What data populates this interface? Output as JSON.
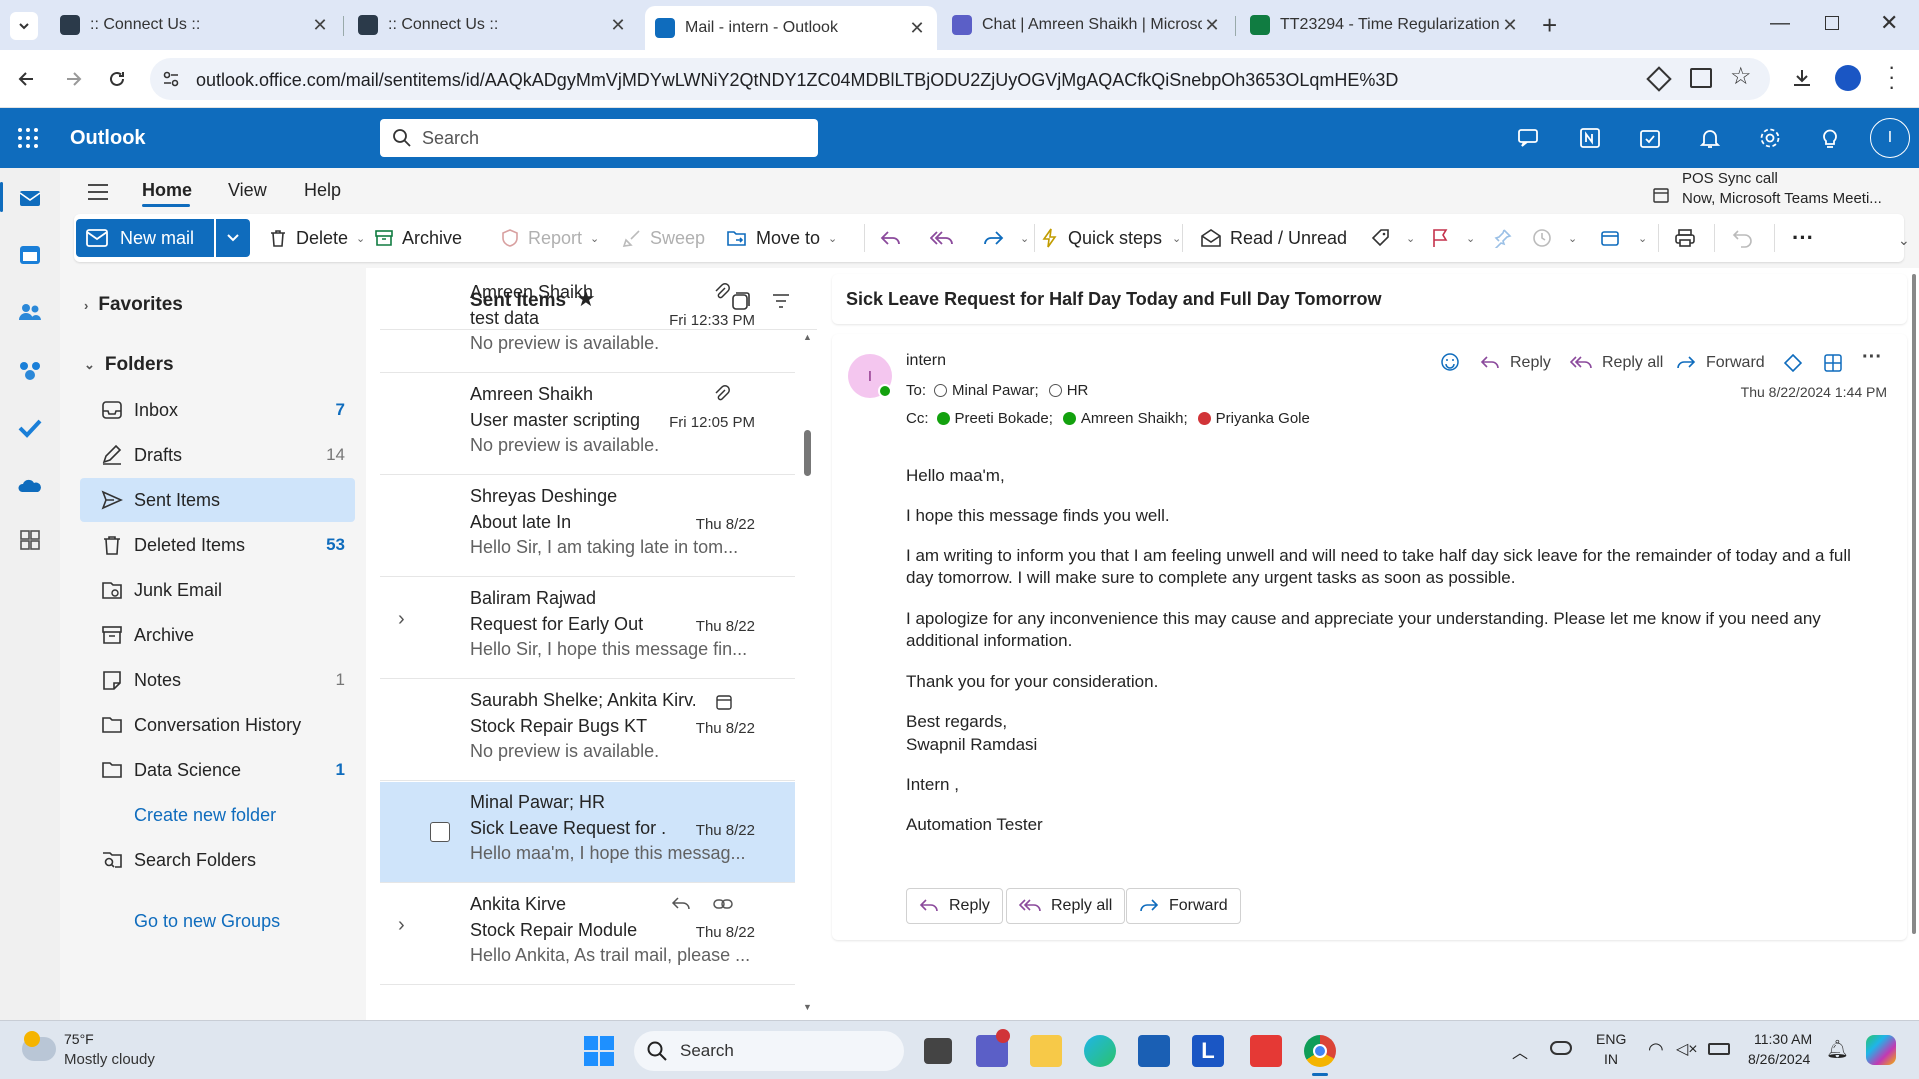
{
  "browser": {
    "tabs": [
      {
        "title": ":: Connect Us ::",
        "active": false
      },
      {
        "title": ":: Connect Us ::",
        "active": false
      },
      {
        "title": "Mail - intern - Outlook",
        "active": true
      },
      {
        "title": "Chat | Amreen Shaikh | Microso",
        "active": false
      },
      {
        "title": "TT23294 - Time Regularization",
        "active": false
      }
    ],
    "url": "outlook.office.com/mail/sentitems/id/AAQkADgyMmVjMDYwLWNiY2QtNDY1ZC04MDBlLTBjODU2ZjUyOGVjMgAQACfkQiSnebpOh3653OLqmHE%3D"
  },
  "header": {
    "app_name": "Outlook",
    "search_placeholder": "Search",
    "avatar_initial": "I"
  },
  "ribbon": {
    "tabs": [
      "Home",
      "View",
      "Help"
    ],
    "active_tab": "Home",
    "reminder_title": "POS Sync call",
    "reminder_sub": "Now, Microsoft Teams Meeti...",
    "commands": {
      "new_mail": "New mail",
      "delete": "Delete",
      "archive": "Archive",
      "report": "Report",
      "sweep": "Sweep",
      "move_to": "Move to",
      "quick_steps": "Quick steps",
      "read_unread": "Read / Unread"
    }
  },
  "folders": {
    "favorites_label": "Favorites",
    "folders_label": "Folders",
    "items": [
      {
        "label": "Inbox",
        "count": "7",
        "bold": true,
        "icon": "inbox-icon"
      },
      {
        "label": "Drafts",
        "count": "14",
        "bold": false,
        "icon": "drafts-icon"
      },
      {
        "label": "Sent Items",
        "count": "",
        "bold": false,
        "icon": "sent-icon"
      },
      {
        "label": "Deleted Items",
        "count": "53",
        "bold": true,
        "icon": "trash-icon"
      },
      {
        "label": "Junk Email",
        "count": "",
        "bold": false,
        "icon": "junk-icon"
      },
      {
        "label": "Archive",
        "count": "",
        "bold": false,
        "icon": "archive-icon"
      },
      {
        "label": "Notes",
        "count": "1",
        "bold": false,
        "icon": "notes-icon"
      },
      {
        "label": "Conversation History",
        "count": "",
        "bold": false,
        "icon": "folder-icon"
      },
      {
        "label": "Data Science",
        "count": "1",
        "bold": true,
        "icon": "folder-icon"
      }
    ],
    "create_new_folder": "Create new folder",
    "search_folders": "Search Folders",
    "go_to_groups": "Go to new Groups"
  },
  "message_list": {
    "title": "Sent Items",
    "messages": [
      {
        "from": "Amreen Shaikh",
        "subject": "test data",
        "date": "Fri 12:33 PM",
        "preview": "No preview is available.",
        "attachment": true
      },
      {
        "from": "Amreen Shaikh",
        "subject": "User master scripting",
        "date": "Fri 12:05 PM",
        "preview": "No preview is available.",
        "attachment": true
      },
      {
        "from": "Shreyas Deshinge",
        "subject": "About late In",
        "date": "Thu 8/22",
        "preview": "Hello Sir, I am taking late in tom...",
        "attachment": false
      },
      {
        "from": "Baliram Rajwad",
        "subject": "Request for Early Out",
        "date": "Thu 8/22",
        "preview": "Hello Sir, I hope this message fin...",
        "attachment": false
      },
      {
        "from": "Saurabh Shelke; Ankita Kirv...",
        "subject": "Stock Repair Bugs KT",
        "date": "Thu 8/22",
        "preview": "No preview is available.",
        "attachment": false
      },
      {
        "from": "Minal Pawar; HR",
        "subject": "Sick Leave Request for ...",
        "date": "Thu 8/22",
        "preview": "Hello maa'm, I hope this messag...",
        "attachment": false
      },
      {
        "from": "Ankita Kirve",
        "subject": "Stock Repair Module",
        "date": "Thu 8/22",
        "preview": "Hello Ankita, As trail mail, please ...",
        "attachment": false
      }
    ]
  },
  "reading": {
    "subject": "Sick Leave Request for Half Day Today and Full Day Tomorrow",
    "sender_initial": "I",
    "sender": "intern",
    "to_label": "To:",
    "to": [
      "Minal Pawar;",
      "HR"
    ],
    "cc_label": "Cc:",
    "cc": [
      "Preeti Bokade;",
      "Amreen Shaikh;",
      "Priyanka Gole"
    ],
    "datetime": "Thu 8/22/2024 1:44 PM",
    "actions": {
      "reply": "Reply",
      "reply_all": "Reply all",
      "forward": "Forward"
    },
    "body": [
      "Hello maa'm,",
      "I hope this message finds you well.",
      "I am writing to inform you that I am feeling unwell and will need to take half day sick leave for the remainder of today and a full",
      "day tomorrow. I will make sure to complete any urgent tasks as soon as possible.",
      "I apologize for any inconvenience this may cause and appreciate your understanding. Please let me know if you need any",
      "additional information.",
      "Thank you for your consideration.",
      "Best regards,",
      "Swapnil Ramdasi",
      "Intern ,",
      "Automation Tester"
    ]
  },
  "taskbar": {
    "temp": "75°F",
    "weather": "Mostly cloudy",
    "search": "Search",
    "lang1": "ENG",
    "lang2": "IN",
    "time": "11:30 AM",
    "date": "8/26/2024"
  },
  "colors": {
    "brand": "#0f6cbd",
    "selected": "#cfe4fa"
  }
}
